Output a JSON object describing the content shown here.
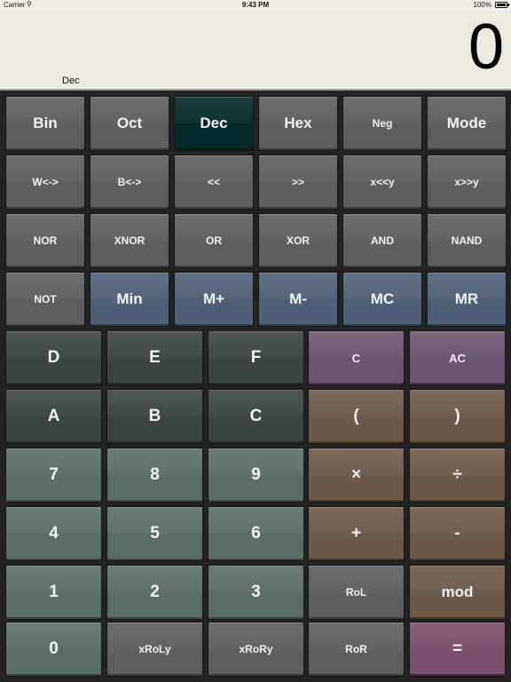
{
  "status_bar": {
    "carrier": "Carrier",
    "time": "9:43 PM",
    "battery": "100%"
  },
  "display": {
    "value": "0",
    "mode": "Dec"
  },
  "colors": {
    "gray": "#5d5e60",
    "blue": "#4e6077",
    "dark_green": "#3b443f",
    "green": "#5a6e66",
    "brown": "#6c5948",
    "mauve": "#6a5570",
    "pink": "#7a4f69",
    "selected": "#062a29"
  },
  "keys": {
    "bin": "Bin",
    "oct": "Oct",
    "dec": "Dec",
    "hex": "Hex",
    "neg": "Neg",
    "mode": "Mode",
    "w_swap": "W<->",
    "b_swap": "B<->",
    "shl": "<<",
    "shr": ">>",
    "x_shl_y": "x<<y",
    "x_shr_y": "x>>y",
    "nor": "NOR",
    "xnor": "XNOR",
    "or": "OR",
    "xor": "XOR",
    "and": "AND",
    "nand": "NAND",
    "not": "NOT",
    "min": "Min",
    "m_plus": "M+",
    "m_minus": "M-",
    "mc": "MC",
    "mr": "MR",
    "d": "D",
    "e": "E",
    "f": "F",
    "clear": "C",
    "all_clear": "AC",
    "a": "A",
    "b": "B",
    "c": "C",
    "lparen": "(",
    "rparen": ")",
    "seven": "7",
    "eight": "8",
    "nine": "9",
    "multiply": "×",
    "divide": "÷",
    "four": "4",
    "five": "5",
    "six": "6",
    "plus": "+",
    "minus": "-",
    "one": "1",
    "two": "2",
    "three": "3",
    "rol": "RoL",
    "mod": "mod",
    "zero": "0",
    "xroly": "xRoLy",
    "xrory": "xRoRy",
    "ror": "RoR",
    "equals": "="
  }
}
